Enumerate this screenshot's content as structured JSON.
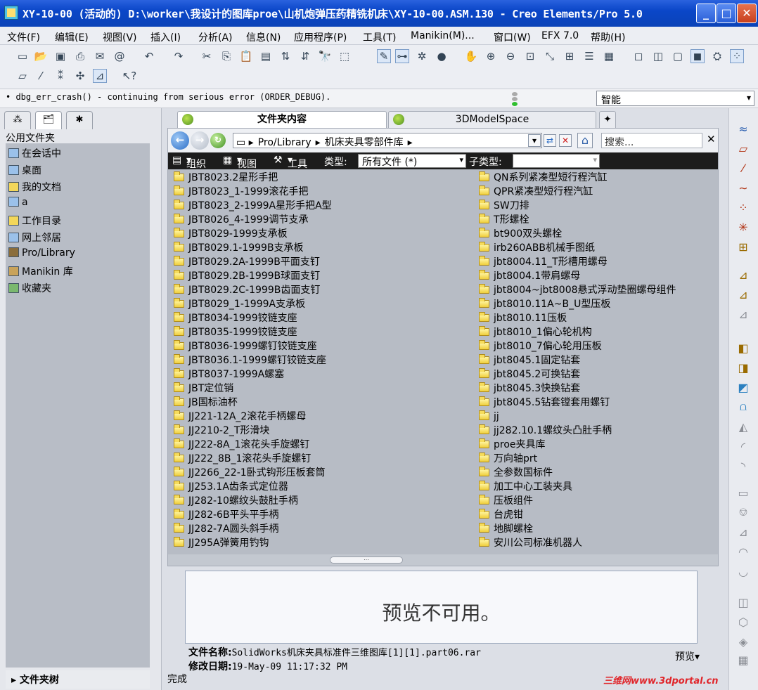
{
  "window": {
    "title": "XY-10-00 (活动的) D:\\worker\\我设计的图库proe\\山机炮弹压药精铣机床\\XY-10-00.ASM.130 - Creo Elements/Pro 5.0",
    "min": "_",
    "max": "□",
    "close": "✕"
  },
  "menu": [
    "文件(F)",
    "编辑(E)",
    "视图(V)",
    "插入(I)",
    "分析(A)",
    "信息(N)",
    "应用程序(P)",
    "工具(T)",
    "Manikin(M)...",
    "窗口(W)",
    "EFX 7.0",
    "帮助(H)"
  ],
  "message": "• dbg_err_crash() - continuing from serious error (ORDER_DEBUG).",
  "filter": "智能",
  "left_panel": {
    "header": "公用文件夹",
    "items": [
      "在会话中",
      "桌面",
      "我的文档",
      "a",
      "工作目录",
      "网上邻居",
      "Pro/Library",
      "Manikin 库",
      "收藏夹"
    ],
    "footer": "▸ 文件夹树"
  },
  "tabs": {
    "folder": "文件夹内容",
    "space": "3DModelSpace"
  },
  "address": {
    "crumbs": [
      "Pro/Library",
      "▸",
      "机床夹具零部件库",
      "▸"
    ],
    "search_placeholder": "搜索..."
  },
  "commandbar": {
    "organize": "组织",
    "view": "视图",
    "tools": "工具",
    "type_label": "类型:",
    "type_value": "所有文件 (*)",
    "subtype_label": "子类型:"
  },
  "files_left": [
    "JBT8023.2星形手把",
    "JBT8023_1-1999滚花手把",
    "JBT8023_2-1999A星形手把A型",
    "JBT8026_4-1999调节支承",
    "JBT8029-1999支承板",
    "JBT8029.1-1999B支承板",
    "JBT8029.2A-1999B平面支钉",
    "JBT8029.2B-1999B球面支钉",
    "JBT8029.2C-1999B齿面支钉",
    "JBT8029_1-1999A支承板",
    "JBT8034-1999铰链支座",
    "JBT8035-1999铰链支座",
    "JBT8036-1999螺钉铰链支座",
    "JBT8036.1-1999螺钉铰链支座",
    "JBT8037-1999A螺塞",
    "JBT定位销",
    "JB国标油杯",
    "JJ221-12A_2滚花手柄螺母",
    "JJ2210-2_T形滑块",
    "JJ222-8A_1滚花头手旋螺钉",
    "JJ222_8B_1滚花头手旋螺钉",
    "JJ2266_22-1卧式钩形压板套筒",
    "JJ253.1A齿条式定位器",
    "JJ282-10螺纹头鼓肚手柄",
    "JJ282-6B平头平手柄",
    "JJ282-7A圆头斜手柄",
    "JJ295A弹簧用钓钩"
  ],
  "files_right": [
    "QN系列紧凑型短行程汽缸",
    "QPR紧凑型短行程汽缸",
    "SW刀排",
    "T形螺栓",
    "bt900双头螺栓",
    "irb260ABB机械手图纸",
    "jbt8004.11_T形槽用螺母",
    "jbt8004.1带肩螺母",
    "jbt8004~jbt8008悬式浮动垫圈螺母组件",
    "jbt8010.11A~B_U型压板",
    "jbt8010.11压板",
    "jbt8010_1偏心轮机构",
    "jbt8010_7偏心轮用压板",
    "jbt8045.1固定钻套",
    "jbt8045.2可换钻套",
    "jbt8045.3快换钻套",
    "jbt8045.5钻套镗套用螺钉",
    "jj",
    "jj282.10.1螺纹头凸肚手柄",
    "proe夹具库",
    "万向轴prt",
    "全参数国标件",
    "加工中心工装夹具",
    "压板组件",
    "台虎钳",
    "地脚螺栓",
    "安川公司标准机器人"
  ],
  "preview": {
    "text": "预览不可用。",
    "name_label": "文件名称:",
    "name_value": "SolidWorks机床夹具标准件三维图库[1][1].part06.rar",
    "date_label": "修改日期:",
    "date_value": "19-May-09 11:17:32 PM",
    "button": "预览▾"
  },
  "status": "完成",
  "watermark": "三维网www.3dportal.cn"
}
